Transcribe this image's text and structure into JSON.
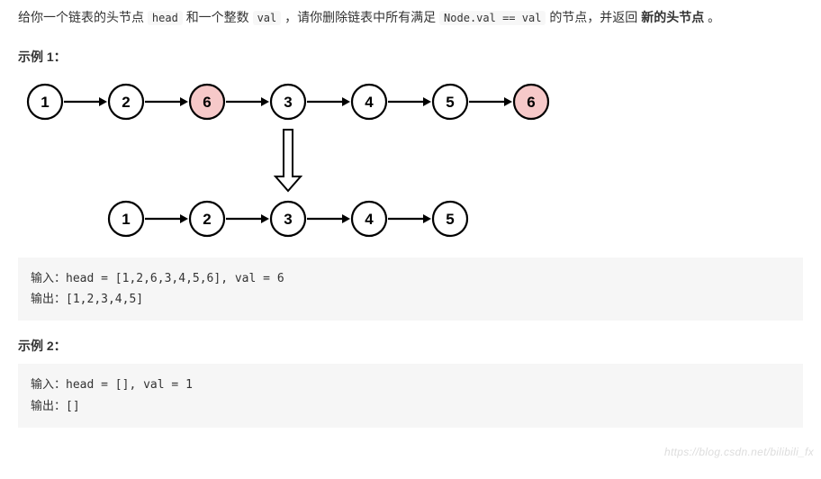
{
  "problem": {
    "prefix": "给你一个链表的头节点 ",
    "code1": "head",
    "mid1": " 和一个整数 ",
    "code2": "val",
    "mid2": " ，请你删除链表中所有满足 ",
    "code3": "Node.val == val",
    "mid3": " 的节点，并返回 ",
    "bold": "新的头节点",
    "suffix": " 。"
  },
  "example1": {
    "title": "示例 1：",
    "input_label": "输入：",
    "input_value": "head = [1,2,6,3,4,5,6], val = 6",
    "output_label": "输出：",
    "output_value": "[1,2,3,4,5]"
  },
  "example2": {
    "title": "示例 2：",
    "input_label": "输入：",
    "input_value": "head = [], val = 1",
    "output_label": "输出：",
    "output_value": "[]"
  },
  "diagram": {
    "top_nodes": [
      {
        "val": "1",
        "hl": false
      },
      {
        "val": "2",
        "hl": false
      },
      {
        "val": "6",
        "hl": true
      },
      {
        "val": "3",
        "hl": false
      },
      {
        "val": "4",
        "hl": false
      },
      {
        "val": "5",
        "hl": false
      },
      {
        "val": "6",
        "hl": true
      }
    ],
    "bottom_nodes": [
      {
        "val": "1",
        "hl": false
      },
      {
        "val": "2",
        "hl": false
      },
      {
        "val": "3",
        "hl": false
      },
      {
        "val": "4",
        "hl": false
      },
      {
        "val": "5",
        "hl": false
      }
    ]
  },
  "watermark": "https://blog.csdn.net/bilibili_fx"
}
